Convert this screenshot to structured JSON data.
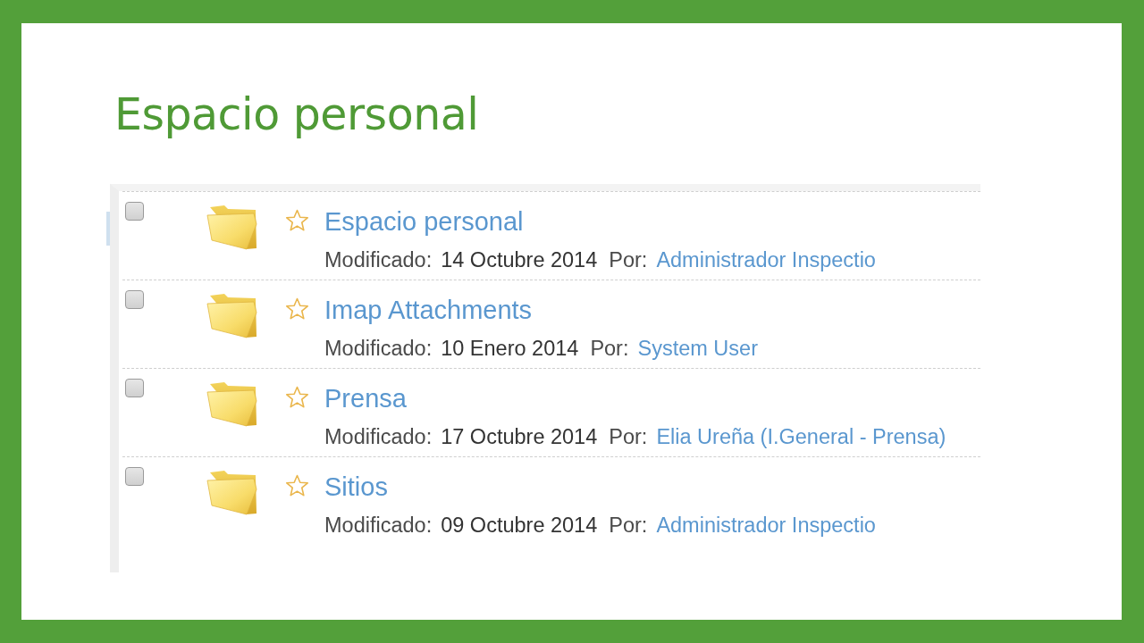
{
  "slide": {
    "title": "Espacio personal"
  },
  "list": {
    "items": [
      {
        "checked": false,
        "starred": false,
        "name": "Espacio personal",
        "modified_label": "Modificado:",
        "modified_date": "14 Octubre 2014",
        "author_label": "Por:",
        "author": "Administrador Inspectio"
      },
      {
        "checked": false,
        "starred": false,
        "name": "Imap Attachments",
        "modified_label": "Modificado:",
        "modified_date": "10 Enero 2014",
        "author_label": "Por:",
        "author": "System User"
      },
      {
        "checked": false,
        "starred": false,
        "name": "Prensa",
        "modified_label": "Modificado:",
        "modified_date": "17 Octubre 2014",
        "author_label": "Por:",
        "author": "Elia Ureña (I.General - Prensa)"
      },
      {
        "checked": false,
        "starred": false,
        "name": "Sitios",
        "modified_label": "Modificado:",
        "modified_date": "09 Octubre 2014",
        "author_label": "Por:",
        "author": "Administrador Inspectio"
      }
    ]
  }
}
